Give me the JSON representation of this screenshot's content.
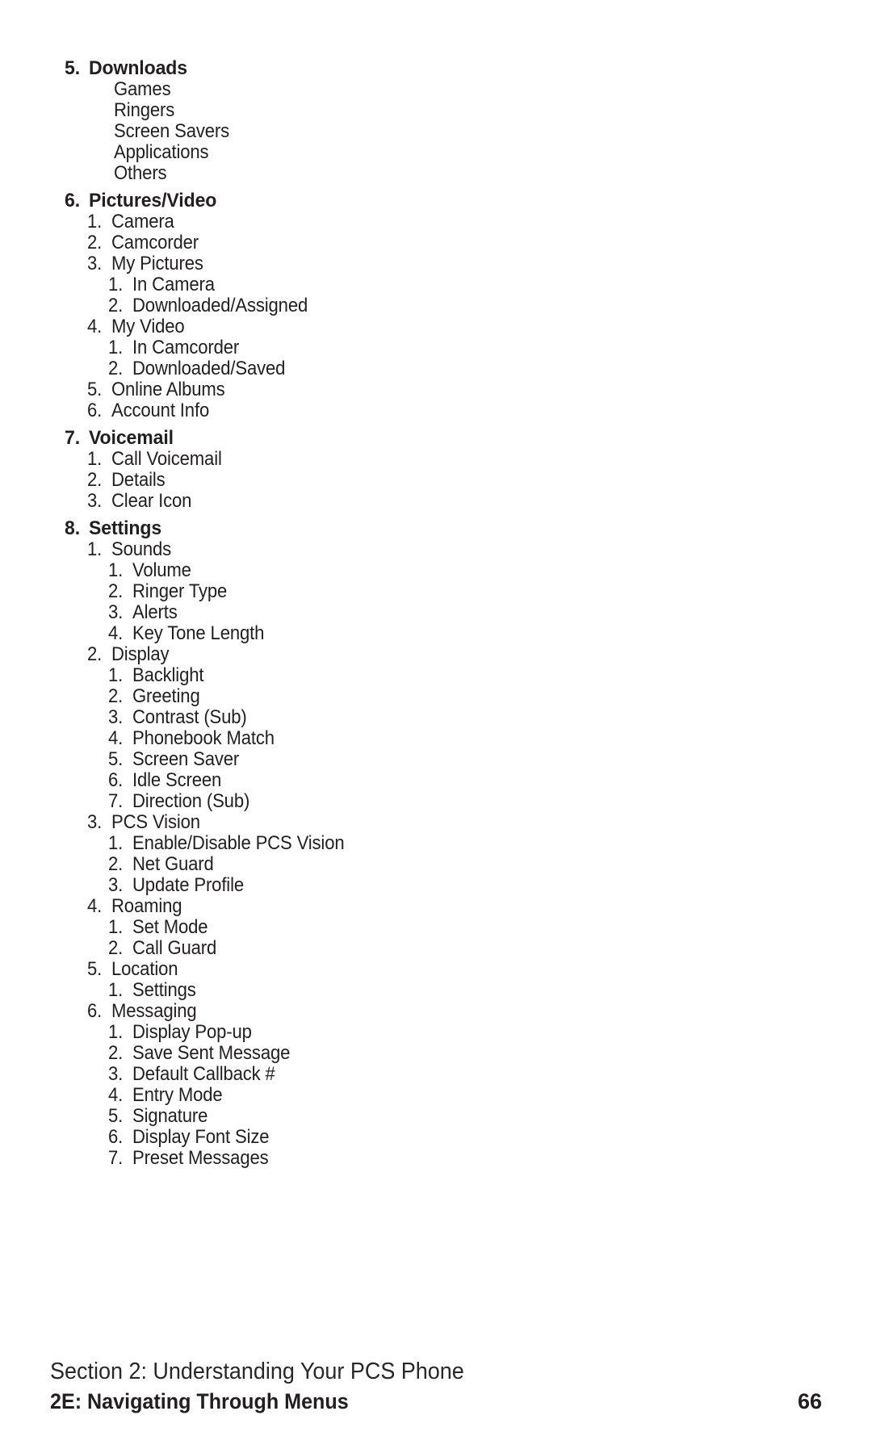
{
  "document": {
    "type": "phone-user-manual-page",
    "page_number": "66",
    "text_color": "#231f20"
  },
  "outline": {
    "rows": [
      {
        "level": 1,
        "marker": "5.",
        "label": "Downloads"
      },
      {
        "level": 2,
        "marker": "",
        "label": "Games"
      },
      {
        "level": 2,
        "marker": "",
        "label": "Ringers"
      },
      {
        "level": 2,
        "marker": "",
        "label": "Screen Savers"
      },
      {
        "level": 2,
        "marker": "",
        "label": "Applications"
      },
      {
        "level": 2,
        "marker": "",
        "label": "Others"
      },
      {
        "level": 1,
        "marker": "6.",
        "label": "Pictures/Video"
      },
      {
        "level": 2,
        "marker": "1.",
        "label": "Camera"
      },
      {
        "level": 2,
        "marker": "2.",
        "label": "Camcorder"
      },
      {
        "level": 2,
        "marker": "3.",
        "label": "My Pictures"
      },
      {
        "level": 3,
        "marker": "1.",
        "label": "In Camera"
      },
      {
        "level": 3,
        "marker": "2.",
        "label": "Downloaded/Assigned"
      },
      {
        "level": 2,
        "marker": "4.",
        "label": "My Video"
      },
      {
        "level": 3,
        "marker": "1.",
        "label": "In Camcorder"
      },
      {
        "level": 3,
        "marker": "2.",
        "label": "Downloaded/Saved"
      },
      {
        "level": 2,
        "marker": "5.",
        "label": "Online Albums"
      },
      {
        "level": 2,
        "marker": "6.",
        "label": "Account Info"
      },
      {
        "level": 1,
        "marker": "7.",
        "label": "Voicemail"
      },
      {
        "level": 2,
        "marker": "1.",
        "label": "Call Voicemail"
      },
      {
        "level": 2,
        "marker": "2.",
        "label": "Details"
      },
      {
        "level": 2,
        "marker": "3.",
        "label": "Clear Icon"
      },
      {
        "level": 1,
        "marker": "8.",
        "label": "Settings"
      },
      {
        "level": 2,
        "marker": "1.",
        "label": "Sounds"
      },
      {
        "level": 3,
        "marker": "1.",
        "label": "Volume"
      },
      {
        "level": 3,
        "marker": "2.",
        "label": "Ringer Type"
      },
      {
        "level": 3,
        "marker": "3.",
        "label": "Alerts"
      },
      {
        "level": 3,
        "marker": "4.",
        "label": "Key Tone Length"
      },
      {
        "level": 2,
        "marker": "2.",
        "label": "Display"
      },
      {
        "level": 3,
        "marker": "1.",
        "label": "Backlight"
      },
      {
        "level": 3,
        "marker": "2.",
        "label": "Greeting"
      },
      {
        "level": 3,
        "marker": "3.",
        "label": "Contrast (Sub)"
      },
      {
        "level": 3,
        "marker": "4.",
        "label": "Phonebook Match"
      },
      {
        "level": 3,
        "marker": "5.",
        "label": "Screen Saver"
      },
      {
        "level": 3,
        "marker": "6.",
        "label": "Idle Screen"
      },
      {
        "level": 3,
        "marker": "7.",
        "label": "Direction (Sub)"
      },
      {
        "level": 2,
        "marker": "3.",
        "label": "PCS Vision"
      },
      {
        "level": 3,
        "marker": "1.",
        "label": "Enable/Disable PCS Vision"
      },
      {
        "level": 3,
        "marker": "2.",
        "label": "Net Guard"
      },
      {
        "level": 3,
        "marker": "3.",
        "label": "Update Profile"
      },
      {
        "level": 2,
        "marker": "4.",
        "label": "Roaming"
      },
      {
        "level": 3,
        "marker": "1.",
        "label": "Set Mode"
      },
      {
        "level": 3,
        "marker": "2.",
        "label": "Call Guard"
      },
      {
        "level": 2,
        "marker": "5.",
        "label": "Location"
      },
      {
        "level": 3,
        "marker": "1.",
        "label": "Settings"
      },
      {
        "level": 2,
        "marker": "6.",
        "label": "Messaging"
      },
      {
        "level": 3,
        "marker": "1.",
        "label": "Display Pop-up"
      },
      {
        "level": 3,
        "marker": "2.",
        "label": "Save Sent Message"
      },
      {
        "level": 3,
        "marker": "3.",
        "label": "Default Callback #"
      },
      {
        "level": 3,
        "marker": "4.",
        "label": "Entry Mode"
      },
      {
        "level": 3,
        "marker": "5.",
        "label": "Signature"
      },
      {
        "level": 3,
        "marker": "6.",
        "label": "Display Font Size"
      },
      {
        "level": 3,
        "marker": "7.",
        "label": "Preset Messages"
      }
    ]
  },
  "footer": {
    "section": "Section 2: Understanding Your PCS Phone",
    "chapter": "2E: Navigating Through Menus",
    "page_number": "66"
  }
}
